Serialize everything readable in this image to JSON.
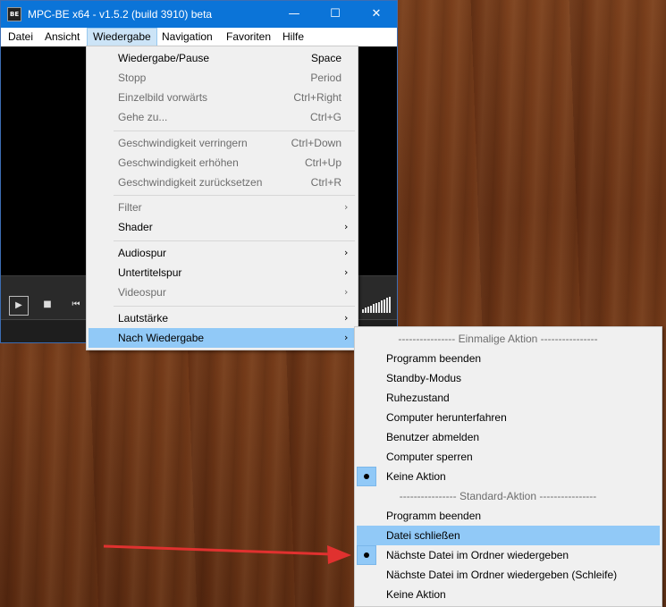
{
  "window": {
    "title": "MPC-BE x64 - v1.5.2 (build 3910) beta",
    "icon_text": "BE",
    "controls": {
      "minimize": "—",
      "maximize": "☐",
      "close": "✕"
    }
  },
  "menubar": {
    "items": [
      {
        "label": "Datei"
      },
      {
        "label": "Ansicht"
      },
      {
        "label": "Wiedergabe"
      },
      {
        "label": "Navigation"
      },
      {
        "label": "Favoriten"
      },
      {
        "label": "Hilfe"
      }
    ]
  },
  "playback_menu": {
    "items": [
      {
        "label": "Wiedergabe/Pause",
        "shortcut": "Space",
        "enabled": true
      },
      {
        "label": "Stopp",
        "shortcut": "Period",
        "enabled": false
      },
      {
        "label": "Einzelbild vorwärts",
        "shortcut": "Ctrl+Right",
        "enabled": false
      },
      {
        "label": "Gehe zu...",
        "shortcut": "Ctrl+G",
        "enabled": false
      },
      {
        "label": "Geschwindigkeit verringern",
        "shortcut": "Ctrl+Down",
        "enabled": false
      },
      {
        "label": "Geschwindigkeit erhöhen",
        "shortcut": "Ctrl+Up",
        "enabled": false
      },
      {
        "label": "Geschwindigkeit zurücksetzen",
        "shortcut": "Ctrl+R",
        "enabled": false
      },
      {
        "label": "Filter",
        "enabled": false
      },
      {
        "label": "Shader",
        "enabled": true
      },
      {
        "label": "Audiospur",
        "enabled": true
      },
      {
        "label": "Untertitelspur",
        "enabled": true
      },
      {
        "label": "Videospur",
        "enabled": false
      },
      {
        "label": "Lautstärke",
        "enabled": true
      },
      {
        "label": "Nach Wiedergabe",
        "enabled": true,
        "highlighted": true
      }
    ],
    "submenu_arrow": "›"
  },
  "after_playback_menu": {
    "header_once": "---------------- Einmalige Aktion ----------------",
    "once_items": [
      {
        "label": "Programm beenden"
      },
      {
        "label": "Standby-Modus"
      },
      {
        "label": "Ruhezustand"
      },
      {
        "label": "Computer herunterfahren"
      },
      {
        "label": "Benutzer abmelden"
      },
      {
        "label": "Computer sperren"
      },
      {
        "label": "Keine Aktion",
        "selected": true
      }
    ],
    "header_default": "---------------- Standard-Aktion ----------------",
    "default_items": [
      {
        "label": "Programm beenden"
      },
      {
        "label": "Datei schließen",
        "highlighted": true
      },
      {
        "label": "Nächste Datei im Ordner wiedergeben",
        "selected": true
      },
      {
        "label": "Nächste Datei im Ordner wiedergeben (Schleife)"
      },
      {
        "label": "Keine Aktion"
      }
    ]
  },
  "player_controls": {
    "play": "▶",
    "stop": "■",
    "prev": "⏮"
  },
  "annotation": {
    "color": "#e0312f"
  }
}
